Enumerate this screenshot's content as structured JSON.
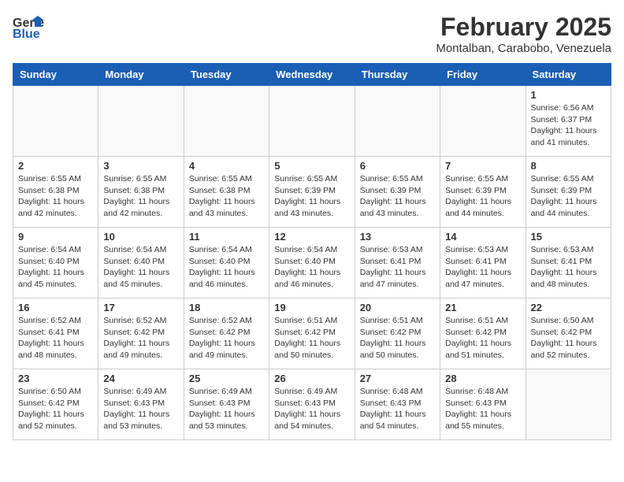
{
  "header": {
    "logo_general": "General",
    "logo_blue": "Blue",
    "month_year": "February 2025",
    "location": "Montalban, Carabobo, Venezuela"
  },
  "days_of_week": [
    "Sunday",
    "Monday",
    "Tuesday",
    "Wednesday",
    "Thursday",
    "Friday",
    "Saturday"
  ],
  "weeks": [
    [
      {
        "day": "",
        "info": ""
      },
      {
        "day": "",
        "info": ""
      },
      {
        "day": "",
        "info": ""
      },
      {
        "day": "",
        "info": ""
      },
      {
        "day": "",
        "info": ""
      },
      {
        "day": "",
        "info": ""
      },
      {
        "day": "1",
        "info": "Sunrise: 6:56 AM\nSunset: 6:37 PM\nDaylight: 11 hours and 41 minutes."
      }
    ],
    [
      {
        "day": "2",
        "info": "Sunrise: 6:55 AM\nSunset: 6:38 PM\nDaylight: 11 hours and 42 minutes."
      },
      {
        "day": "3",
        "info": "Sunrise: 6:55 AM\nSunset: 6:38 PM\nDaylight: 11 hours and 42 minutes."
      },
      {
        "day": "4",
        "info": "Sunrise: 6:55 AM\nSunset: 6:38 PM\nDaylight: 11 hours and 43 minutes."
      },
      {
        "day": "5",
        "info": "Sunrise: 6:55 AM\nSunset: 6:39 PM\nDaylight: 11 hours and 43 minutes."
      },
      {
        "day": "6",
        "info": "Sunrise: 6:55 AM\nSunset: 6:39 PM\nDaylight: 11 hours and 43 minutes."
      },
      {
        "day": "7",
        "info": "Sunrise: 6:55 AM\nSunset: 6:39 PM\nDaylight: 11 hours and 44 minutes."
      },
      {
        "day": "8",
        "info": "Sunrise: 6:55 AM\nSunset: 6:39 PM\nDaylight: 11 hours and 44 minutes."
      }
    ],
    [
      {
        "day": "9",
        "info": "Sunrise: 6:54 AM\nSunset: 6:40 PM\nDaylight: 11 hours and 45 minutes."
      },
      {
        "day": "10",
        "info": "Sunrise: 6:54 AM\nSunset: 6:40 PM\nDaylight: 11 hours and 45 minutes."
      },
      {
        "day": "11",
        "info": "Sunrise: 6:54 AM\nSunset: 6:40 PM\nDaylight: 11 hours and 46 minutes."
      },
      {
        "day": "12",
        "info": "Sunrise: 6:54 AM\nSunset: 6:40 PM\nDaylight: 11 hours and 46 minutes."
      },
      {
        "day": "13",
        "info": "Sunrise: 6:53 AM\nSunset: 6:41 PM\nDaylight: 11 hours and 47 minutes."
      },
      {
        "day": "14",
        "info": "Sunrise: 6:53 AM\nSunset: 6:41 PM\nDaylight: 11 hours and 47 minutes."
      },
      {
        "day": "15",
        "info": "Sunrise: 6:53 AM\nSunset: 6:41 PM\nDaylight: 11 hours and 48 minutes."
      }
    ],
    [
      {
        "day": "16",
        "info": "Sunrise: 6:52 AM\nSunset: 6:41 PM\nDaylight: 11 hours and 48 minutes."
      },
      {
        "day": "17",
        "info": "Sunrise: 6:52 AM\nSunset: 6:42 PM\nDaylight: 11 hours and 49 minutes."
      },
      {
        "day": "18",
        "info": "Sunrise: 6:52 AM\nSunset: 6:42 PM\nDaylight: 11 hours and 49 minutes."
      },
      {
        "day": "19",
        "info": "Sunrise: 6:51 AM\nSunset: 6:42 PM\nDaylight: 11 hours and 50 minutes."
      },
      {
        "day": "20",
        "info": "Sunrise: 6:51 AM\nSunset: 6:42 PM\nDaylight: 11 hours and 50 minutes."
      },
      {
        "day": "21",
        "info": "Sunrise: 6:51 AM\nSunset: 6:42 PM\nDaylight: 11 hours and 51 minutes."
      },
      {
        "day": "22",
        "info": "Sunrise: 6:50 AM\nSunset: 6:42 PM\nDaylight: 11 hours and 52 minutes."
      }
    ],
    [
      {
        "day": "23",
        "info": "Sunrise: 6:50 AM\nSunset: 6:42 PM\nDaylight: 11 hours and 52 minutes."
      },
      {
        "day": "24",
        "info": "Sunrise: 6:49 AM\nSunset: 6:43 PM\nDaylight: 11 hours and 53 minutes."
      },
      {
        "day": "25",
        "info": "Sunrise: 6:49 AM\nSunset: 6:43 PM\nDaylight: 11 hours and 53 minutes."
      },
      {
        "day": "26",
        "info": "Sunrise: 6:49 AM\nSunset: 6:43 PM\nDaylight: 11 hours and 54 minutes."
      },
      {
        "day": "27",
        "info": "Sunrise: 6:48 AM\nSunset: 6:43 PM\nDaylight: 11 hours and 54 minutes."
      },
      {
        "day": "28",
        "info": "Sunrise: 6:48 AM\nSunset: 6:43 PM\nDaylight: 11 hours and 55 minutes."
      },
      {
        "day": "",
        "info": ""
      }
    ]
  ]
}
